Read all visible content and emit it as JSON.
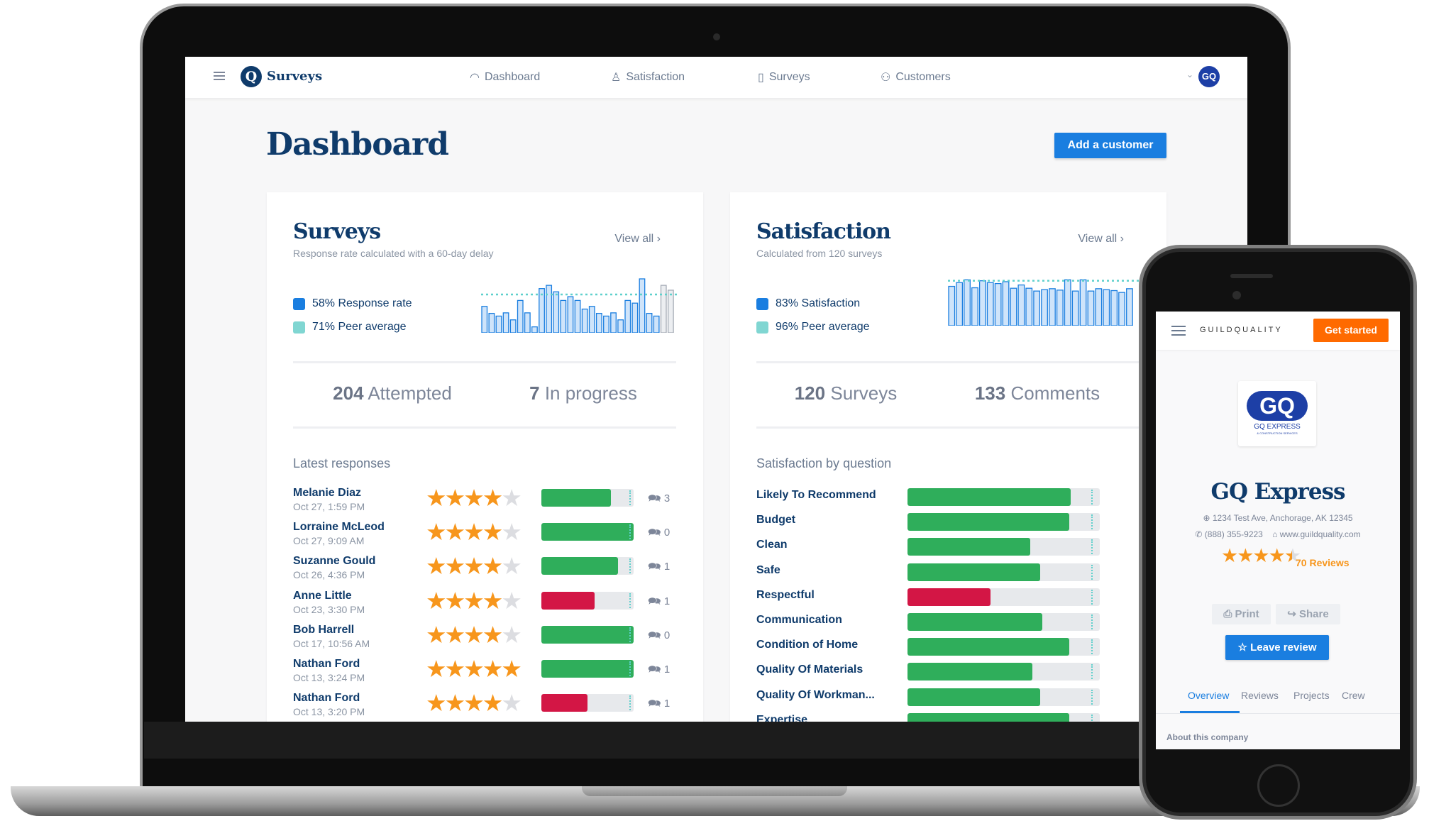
{
  "app": {
    "title": "Surveys",
    "logo_letter": "Q",
    "avatar": "GQ"
  },
  "nav": [
    {
      "label": "Dashboard",
      "icon": "gauge-icon"
    },
    {
      "label": "Satisfaction",
      "icon": "satisfaction-icon"
    },
    {
      "label": "Surveys",
      "icon": "clipboard-icon"
    },
    {
      "label": "Customers",
      "icon": "users-icon"
    }
  ],
  "page": {
    "title": "Dashboard",
    "add_button": "Add a customer"
  },
  "surveys_card": {
    "title": "Surveys",
    "subtitle": "Response rate calculated with a 60-day delay",
    "view_all": "View all",
    "legend": [
      {
        "label": "58% Response rate",
        "color": "#1a7ee0"
      },
      {
        "label": "71% Peer average",
        "color": "#80d6d2"
      }
    ],
    "stats": [
      {
        "num": "204",
        "label": "Attempted"
      },
      {
        "num": "7",
        "label": "In progress"
      }
    ],
    "section": "Latest responses",
    "responses": [
      {
        "name": "Melanie Diaz",
        "date": "Oct 27, 1:59 PM",
        "stars": 4,
        "score": 0.75,
        "color": "#2fae5b",
        "comments": "3"
      },
      {
        "name": "Lorraine McLeod",
        "date": "Oct 27, 9:09 AM",
        "stars": 4,
        "score": 1.0,
        "color": "#2fae5b",
        "comments": "0"
      },
      {
        "name": "Suzanne Gould",
        "date": "Oct 26, 4:36 PM",
        "stars": 4,
        "score": 0.83,
        "color": "#2fae5b",
        "comments": "1"
      },
      {
        "name": "Anne Little",
        "date": "Oct 23, 3:30 PM",
        "stars": 4,
        "score": 0.58,
        "color": "#d31645",
        "comments": "1"
      },
      {
        "name": "Bob Harrell",
        "date": "Oct 17, 10:56 AM",
        "stars": 4,
        "score": 1.0,
        "color": "#2fae5b",
        "comments": "0"
      },
      {
        "name": "Nathan Ford",
        "date": "Oct 13, 3:24 PM",
        "stars": 5,
        "score": 1.0,
        "color": "#2fae5b",
        "comments": "1"
      },
      {
        "name": "Nathan Ford",
        "date": "Oct 13, 3:20 PM",
        "stars": 4,
        "score": 0.5,
        "color": "#d31645",
        "comments": "1"
      }
    ]
  },
  "satisfaction_card": {
    "title": "Satisfaction",
    "subtitle": "Calculated from 120 surveys",
    "view_all": "View all",
    "legend": [
      {
        "label": "83% Satisfaction",
        "color": "#1a7ee0"
      },
      {
        "label": "96% Peer average",
        "color": "#80d6d2"
      }
    ],
    "stats": [
      {
        "num": "120",
        "label": "Surveys"
      },
      {
        "num": "133",
        "label": "Comments"
      }
    ],
    "section": "Satisfaction by question",
    "questions": [
      {
        "label": "Likely To Recommend",
        "pct": "92%",
        "value": 92,
        "color": "#2fae5b"
      },
      {
        "label": "Budget",
        "pct": "91%",
        "value": 91,
        "color": "#2fae5b"
      },
      {
        "label": "Clean",
        "pct": "71%",
        "value": 71,
        "color": "#2fae5b"
      },
      {
        "label": "Safe",
        "pct": "76%",
        "value": 76,
        "color": "#2fae5b"
      },
      {
        "label": "Respectful",
        "pct": "50%",
        "value": 50,
        "color": "#d31645"
      },
      {
        "label": "Communication",
        "pct": "77%",
        "value": 77,
        "color": "#2fae5b"
      },
      {
        "label": "Condition of Home",
        "pct": "91%",
        "value": 91,
        "color": "#2fae5b"
      },
      {
        "label": "Quality Of Materials",
        "pct": "72%",
        "value": 72,
        "color": "#2fae5b"
      },
      {
        "label": "Quality Of Workman...",
        "pct": "76%",
        "value": 76,
        "color": "#2fae5b"
      },
      {
        "label": "Expertise",
        "pct": "91%",
        "value": 91,
        "color": "#2fae5b"
      }
    ]
  },
  "chart_data": [
    {
      "type": "bar",
      "peer_average": 71,
      "ylim": [
        0,
        100
      ],
      "values": [
        49,
        36,
        31,
        37,
        24,
        60,
        37,
        11,
        82,
        88,
        76,
        60,
        67,
        60,
        44,
        49,
        36,
        31,
        37,
        24,
        60,
        55,
        100,
        36,
        31,
        88,
        79
      ],
      "pending_last": 2
    },
    {
      "type": "bar",
      "peer_average": 96,
      "ylim": [
        0,
        100
      ],
      "values": [
        84,
        92,
        98,
        81,
        96,
        92,
        90,
        94,
        80,
        87,
        80,
        74,
        77,
        79,
        76,
        98,
        74,
        98,
        74,
        79,
        77,
        75,
        71,
        79
      ]
    }
  ],
  "phone": {
    "brand": "GUILDQUALITY",
    "cta": "Get started",
    "logo_text": "GQ",
    "logo_sub": "GQ EXPRESS",
    "logo_sub2": "& CONSTRUCTION SERVICES",
    "company": "GQ Express",
    "address": "1234 Test Ave, Anchorage, AK 12345",
    "phone": "(888) 355-9223",
    "website": "www.guildquality.com",
    "rating": 4.5,
    "reviews": "70 Reviews",
    "print": "Print",
    "share": "Share",
    "leave_review": "Leave review",
    "tabs": [
      "Overview",
      "Reviews",
      "Projects",
      "Crew"
    ],
    "about": "About this company"
  }
}
